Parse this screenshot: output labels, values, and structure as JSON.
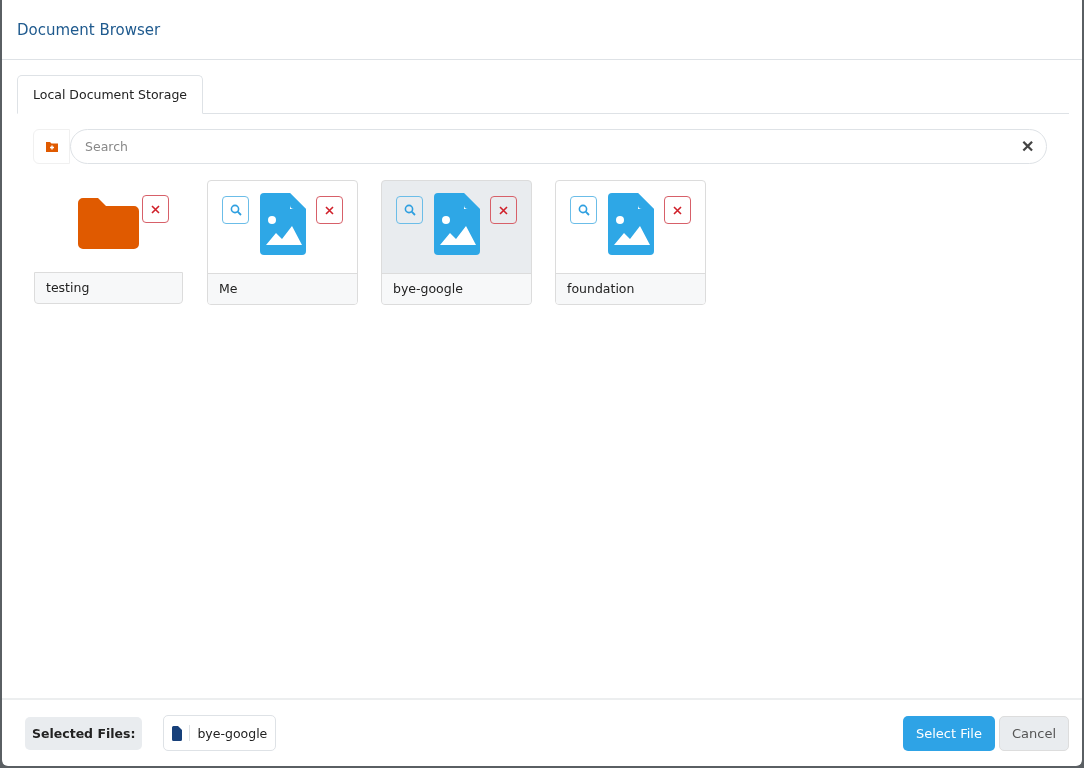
{
  "dialog": {
    "title": "Document Browser"
  },
  "tabs": [
    {
      "label": "Local Document Storage",
      "selected": true
    }
  ],
  "search": {
    "placeholder": "Search",
    "clear": "✕"
  },
  "items": [
    {
      "name": "testing",
      "kind": "folder",
      "selected": false
    },
    {
      "name": "Me",
      "kind": "file",
      "selected": false
    },
    {
      "name": "bye-google",
      "kind": "file",
      "selected": true
    },
    {
      "name": "foundation",
      "kind": "file",
      "selected": false
    }
  ],
  "footer": {
    "selected_label": "Selected Files:",
    "selected_files": [
      "bye-google"
    ],
    "buttons": [
      {
        "label": "Select File",
        "kind": "primary"
      },
      {
        "label": "Cancel",
        "kind": "secondary"
      }
    ]
  }
}
